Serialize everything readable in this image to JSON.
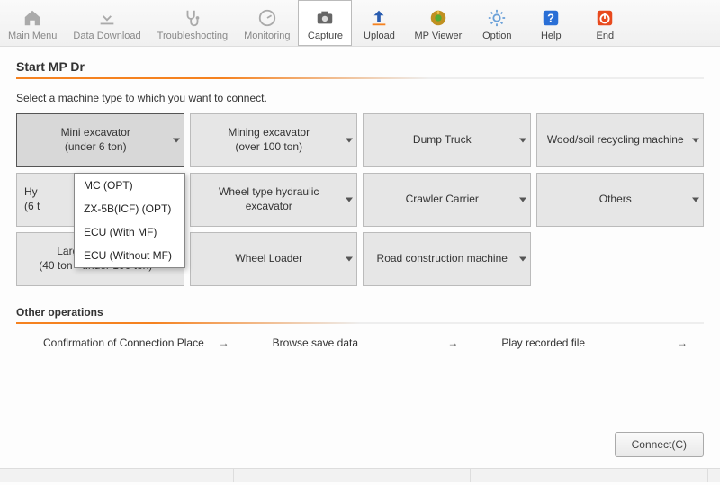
{
  "toolbar": {
    "items": [
      {
        "label": "Main Menu"
      },
      {
        "label": "Data Download"
      },
      {
        "label": "Troubleshooting"
      },
      {
        "label": "Monitoring"
      },
      {
        "label": "Capture"
      },
      {
        "label": "Upload"
      },
      {
        "label": "MP Viewer"
      },
      {
        "label": "Option"
      },
      {
        "label": "Help"
      },
      {
        "label": "End"
      }
    ]
  },
  "page": {
    "title": "Start MP Dr",
    "subtitle": "Select a machine type to which you want to connect."
  },
  "tiles": [
    {
      "label": "Mini excavator\n(under 6 ton)"
    },
    {
      "label": "Mining excavator\n(over 100 ton)"
    },
    {
      "label": "Dump Truck"
    },
    {
      "label": "Wood/soil recycling machine"
    },
    {
      "label": "Hydraulic excavator\n(6 ton - under 40 ton)"
    },
    {
      "label": "Wheel type hydraulic excavator"
    },
    {
      "label": "Crawler Carrier"
    },
    {
      "label": "Others"
    },
    {
      "label": "Large excavator\n(40 ton - under 100 ton)"
    },
    {
      "label": "Wheel Loader"
    },
    {
      "label": "Road construction machine"
    }
  ],
  "dropdown": {
    "items": [
      "MC (OPT)",
      "ZX-5B(ICF) (OPT)",
      "ECU (With MF)",
      "ECU (Without MF)"
    ]
  },
  "other_ops": {
    "title": "Other operations",
    "items": [
      "Confirmation of Connection Place",
      "Browse save data",
      "Play recorded file"
    ]
  },
  "connect_label": "Connect(C)"
}
